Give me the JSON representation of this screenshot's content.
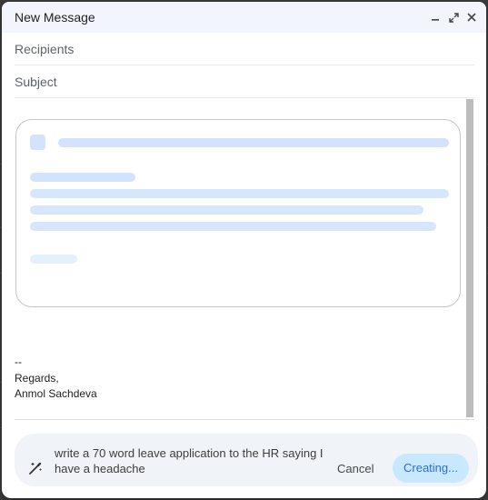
{
  "window": {
    "title": "New Message",
    "minimize_icon": "minimize-icon",
    "expand_icon": "expand-icon",
    "close_icon": "close-icon"
  },
  "fields": {
    "recipients_placeholder": "Recipients",
    "subject_placeholder": "Subject"
  },
  "loading_card": {
    "state": "loading-skeleton"
  },
  "signature": {
    "separator": "--",
    "regards": "Regards,",
    "name": "Anmol Sachdeva"
  },
  "help_me_write": {
    "icon": "magic-wand-icon",
    "prompt": "write a 70 word leave application to the HR saying I have a headache",
    "cancel_label": "Cancel",
    "creating_label": "Creating..."
  },
  "colors": {
    "skeleton_primary": "#d3e3fd",
    "skeleton_light": "#e3f0fd",
    "accent": "#0b57d0",
    "creating_bg": "#c2e7ff"
  }
}
